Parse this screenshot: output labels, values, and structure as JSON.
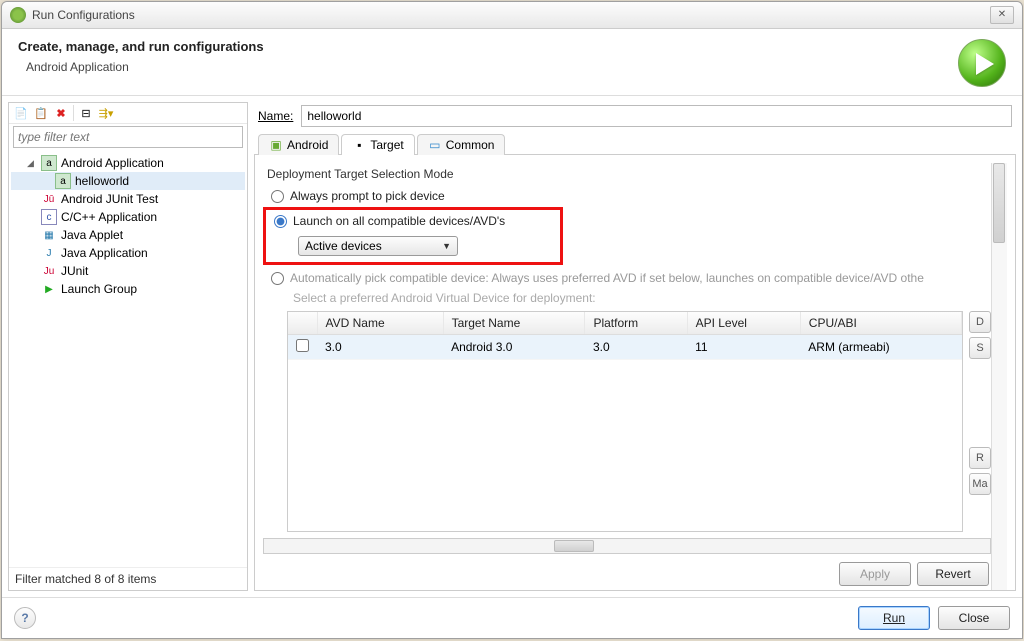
{
  "window": {
    "title": "Run Configurations"
  },
  "header": {
    "title": "Create, manage, and run configurations",
    "subtitle": "Android Application"
  },
  "left": {
    "filter_placeholder": "type filter text",
    "tree": {
      "android_app": "Android Application",
      "helloworld": "helloworld",
      "android_junit": "Android JUnit Test",
      "cpp_app": "C/C++ Application",
      "java_applet": "Java Applet",
      "java_app": "Java Application",
      "junit": "JUnit",
      "launch_group": "Launch Group"
    },
    "status": "Filter matched 8 of 8 items"
  },
  "name_label": "Name:",
  "name_value": "helloworld",
  "tabs": {
    "android": "Android",
    "target": "Target",
    "common": "Common"
  },
  "target_panel": {
    "section": "Deployment Target Selection Mode",
    "opt_prompt": "Always prompt to pick device",
    "opt_launch_all": "Launch on all compatible devices/AVD's",
    "combo_value": "Active devices",
    "opt_auto": "Automatically pick compatible device: Always uses preferred AVD if set below, launches on compatible device/AVD othe",
    "hint": "Select a preferred Android Virtual Device for deployment:",
    "columns": {
      "avd": "AVD Name",
      "target": "Target Name",
      "platform": "Platform",
      "api": "API Level",
      "cpu": "CPU/ABI"
    },
    "row": {
      "avd": "3.0",
      "target": "Android 3.0",
      "platform": "3.0",
      "api": "11",
      "cpu": "ARM (armeabi)"
    },
    "side": {
      "d": "D",
      "s": "S",
      "r": "R",
      "m": "Ma"
    }
  },
  "buttons": {
    "apply": "Apply",
    "revert": "Revert",
    "run": "Run",
    "close": "Close"
  }
}
